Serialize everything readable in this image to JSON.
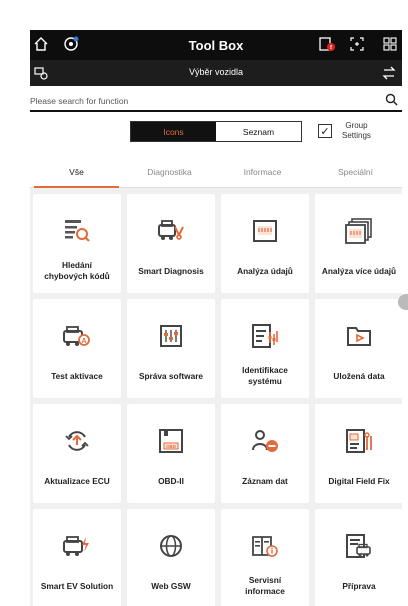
{
  "header": {
    "title": "Tool Box"
  },
  "vehicle_bar": {
    "title": "Výběr vozidla"
  },
  "search": {
    "placeholder": "Please search for function"
  },
  "view_toggle": {
    "icons_label": "Icons",
    "list_label": "Seznam"
  },
  "group_settings": {
    "label": "Group\nSettings",
    "checked": true
  },
  "tabs": [
    {
      "label": "Vše",
      "active": true
    },
    {
      "label": "Diagnostika",
      "active": false
    },
    {
      "label": "Informace",
      "active": false
    },
    {
      "label": "Speciální",
      "active": false
    }
  ],
  "functions": [
    {
      "label": "Hledání\nchybových kódů",
      "icon": "fault-code-search-icon"
    },
    {
      "label": "Smart Diagnosis",
      "icon": "smart-diagnosis-icon"
    },
    {
      "label": "Analýza údajů",
      "icon": "data-analysis-icon"
    },
    {
      "label": "Analýza více údajů",
      "icon": "multi-data-analysis-icon"
    },
    {
      "label": "Test aktivace",
      "icon": "activation-test-icon"
    },
    {
      "label": "Správa software",
      "icon": "software-management-icon"
    },
    {
      "label": "Identifikace\nsystému",
      "icon": "system-identification-icon"
    },
    {
      "label": "Uložená data",
      "icon": "saved-data-icon"
    },
    {
      "label": "Aktualizace ECU",
      "icon": "ecu-update-icon"
    },
    {
      "label": "OBD-II",
      "icon": "obd-ii-icon"
    },
    {
      "label": "Záznam dat",
      "icon": "data-recording-icon"
    },
    {
      "label": "Digital Field Fix",
      "icon": "digital-field-fix-icon"
    },
    {
      "label": "Smart EV Solution",
      "icon": "smart-ev-solution-icon"
    },
    {
      "label": "Web GSW",
      "icon": "web-gsw-icon"
    },
    {
      "label": "Servisní\ninformace",
      "icon": "service-information-icon"
    },
    {
      "label": "Příprava",
      "icon": "preparation-icon"
    }
  ],
  "colors": {
    "accent": "#e36a3a",
    "header_bg": "#0d0d0d",
    "grid_bg": "#f0f0f0"
  }
}
